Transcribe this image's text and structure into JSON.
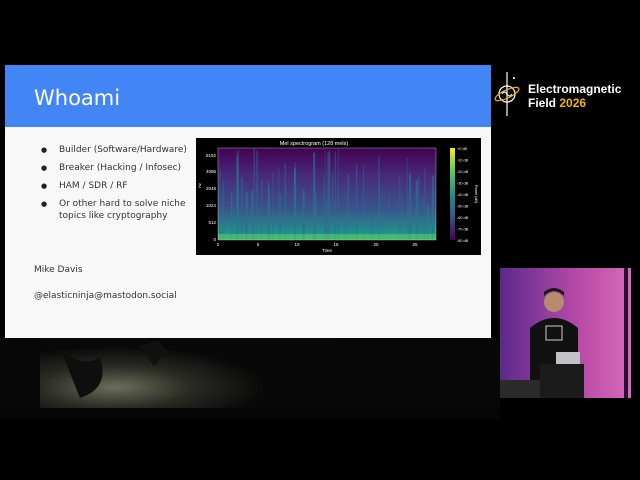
{
  "slide": {
    "title": "Whoami",
    "bullets": [
      "Builder (Software/Hardware)",
      "Breaker (Hacking / Infosec)",
      "HAM / SDR / RF",
      "Or other hard to solve niche topics like cryptography"
    ],
    "author": "Mike Davis",
    "handle": "@elasticninja@mastodon.social",
    "header_color": "#4285f4"
  },
  "spectrogram": {
    "title": "Mel spectrogram (128 mels)",
    "ylabel": "Hz",
    "xlabel": "Time",
    "yticks": [
      "8192",
      "4096",
      "2048",
      "1024",
      "512",
      "0"
    ],
    "xticks": [
      "0",
      "5",
      "10",
      "15",
      "20",
      "25"
    ],
    "colorbar_label": "Power (dB)",
    "colorbar_ticks": [
      "+0 dB",
      "-10 dB",
      "-20 dB",
      "-30 dB",
      "-40 dB",
      "-50 dB",
      "-60 dB",
      "-70 dB",
      "-80 dB"
    ]
  },
  "brand": {
    "line1": "Electromagnetic",
    "line2_prefix": "Field",
    "year": "2026",
    "icon": "emf-logo-icon",
    "year_color": "#f5b400"
  },
  "camera": {
    "icon": "speaker-video-icon"
  }
}
